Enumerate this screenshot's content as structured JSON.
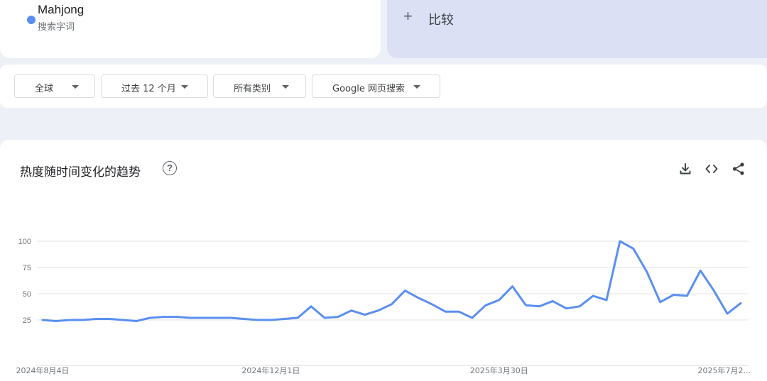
{
  "search_term": {
    "name": "Mahjong",
    "type": "搜索字词",
    "color": "#5b8ff0"
  },
  "compare": {
    "plus": "+",
    "label": "比较"
  },
  "filters": [
    {
      "label": "全球"
    },
    {
      "label": "过去 12 个月"
    },
    {
      "label": "所有类别"
    },
    {
      "label": "Google 网页搜索"
    }
  ],
  "chart_panel": {
    "title": "热度随时间变化的趋势",
    "help": "?",
    "icons": [
      "download-icon",
      "embed-code-icon",
      "share-icon"
    ]
  },
  "chart_data": {
    "type": "line",
    "ylim": [
      0,
      100
    ],
    "yticks": [
      25,
      50,
      75,
      100
    ],
    "xtick_labels": [
      "2024年8月4日",
      "2024年12月1日",
      "2025年3月30日",
      "2025年7月2..."
    ],
    "xtick_indices": [
      0,
      17,
      34,
      52
    ],
    "grid": true,
    "line_color": "#5b8ff0",
    "series": [
      {
        "values": [
          25,
          24,
          25,
          25,
          26,
          26,
          25,
          24,
          27,
          28,
          28,
          27,
          27,
          27,
          27,
          26,
          25,
          25,
          26,
          27,
          38,
          27,
          28,
          34,
          30,
          34,
          40,
          53,
          46,
          40,
          33,
          33,
          27,
          39,
          44,
          57,
          39,
          38,
          43,
          36,
          38,
          48,
          44,
          100,
          93,
          71,
          42,
          49,
          48,
          72,
          53,
          31,
          41
        ]
      }
    ]
  }
}
